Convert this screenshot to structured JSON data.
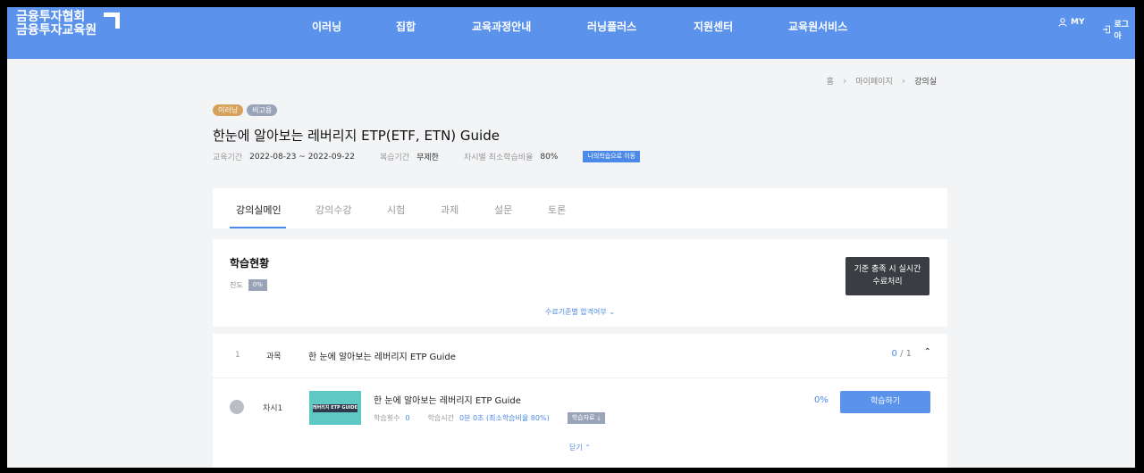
{
  "header": {
    "logo_line1": "금융투자협회",
    "logo_line2": "금융투자교육원",
    "nav": [
      "이러닝",
      "집합",
      "교육과정안내",
      "러닝플러스",
      "지원센터",
      "교육원서비스"
    ],
    "util_my": "MY",
    "util_login": "로그아"
  },
  "breadcrumb": [
    "홈",
    "마이페이지",
    "강의실"
  ],
  "course": {
    "badges": [
      "이러닝",
      "비고용"
    ],
    "title": "한눈에 알아보는 레버리지 ETP(ETF, ETN) Guide",
    "period_label": "교육기간",
    "period_value": "2022-08-23 ~ 2022-09-22",
    "review_label": "복습기간",
    "review_value": "무제한",
    "min_ratio_label": "차시별 최소학습비율",
    "min_ratio_value": "80%",
    "goto_label": "나의학습으로 이동"
  },
  "tabs": [
    "강의실메인",
    "강의수강",
    "시험",
    "과제",
    "설문",
    "토론"
  ],
  "status": {
    "title": "학습현황",
    "progress_label": "진도",
    "progress_value": "0%",
    "realtime_line1": "기준 충족 시 실시간",
    "realtime_line2": "수료처리",
    "criteria_link": "수료기준별 합격여부"
  },
  "subject": {
    "num": "1",
    "kind": "과목",
    "name": "한 눈에 알아보는 레버리지 ETP Guide",
    "done": "0",
    "total": "/ 1",
    "lesson": {
      "label": "차시1",
      "thumb_text": "레버리지 ETP GUIDE",
      "title": "한 눈에 알아보는 레버리지 ETP Guide",
      "count_label": "학습횟수",
      "count_value": "0",
      "time_label": "학습시간",
      "time_value": "0분 0초 (최소학습비율 80%)",
      "material_label": "학습자료",
      "pct": "0%",
      "study_button": "학습하기"
    },
    "close_link": "닫기"
  }
}
